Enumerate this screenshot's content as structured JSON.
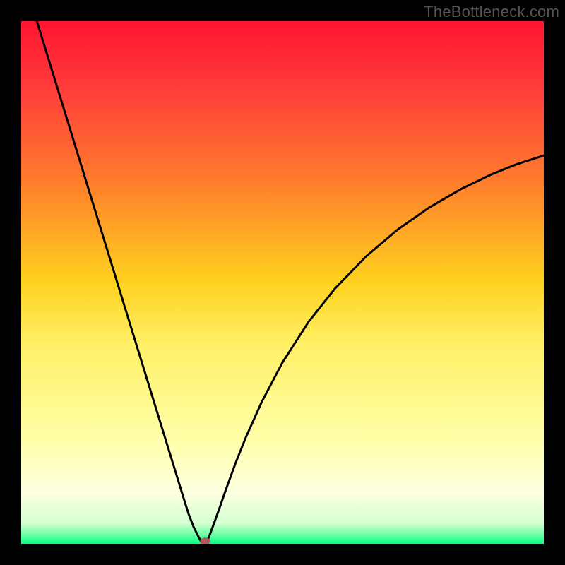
{
  "watermark": "TheBottleneck.com",
  "chart_data": {
    "type": "line",
    "title": "",
    "xlabel": "",
    "ylabel": "",
    "xlim": [
      0,
      100
    ],
    "ylim": [
      0,
      100
    ],
    "gradient_stops": [
      {
        "offset": 0.0,
        "color": "#ff1430"
      },
      {
        "offset": 0.12,
        "color": "#ff3a3a"
      },
      {
        "offset": 0.3,
        "color": "#ff7a2d"
      },
      {
        "offset": 0.5,
        "color": "#ffd21f"
      },
      {
        "offset": 0.62,
        "color": "#fff066"
      },
      {
        "offset": 0.8,
        "color": "#ffffa8"
      },
      {
        "offset": 0.9,
        "color": "#fdffe0"
      },
      {
        "offset": 0.96,
        "color": "#d6ffd0"
      },
      {
        "offset": 0.985,
        "color": "#5fffa0"
      },
      {
        "offset": 1.0,
        "color": "#00ff80"
      }
    ],
    "series": [
      {
        "name": "bottleneck-curve",
        "x": [
          3,
          5,
          7,
          9,
          11,
          13,
          15,
          17,
          19,
          21,
          23,
          25,
          27,
          29,
          31,
          32,
          33,
          34,
          34.5,
          35,
          35.5,
          36,
          37,
          38,
          39,
          41,
          43,
          46,
          50,
          55,
          60,
          66,
          72,
          78,
          84,
          90,
          95,
          100
        ],
        "values": [
          100,
          93.5,
          87,
          80.5,
          74,
          67.5,
          61,
          54.5,
          48,
          41.5,
          35,
          28.5,
          22,
          15.5,
          9,
          5.8,
          3.2,
          1.2,
          0.3,
          0,
          0.3,
          1.5,
          4.2,
          7.0,
          9.9,
          15.4,
          20.4,
          27.1,
          34.7,
          42.5,
          48.8,
          55.0,
          60.1,
          64.3,
          67.8,
          70.7,
          72.7,
          74.3
        ]
      }
    ],
    "marker": {
      "x": 35.2,
      "y": 0.5,
      "color": "#b55a5a"
    }
  }
}
